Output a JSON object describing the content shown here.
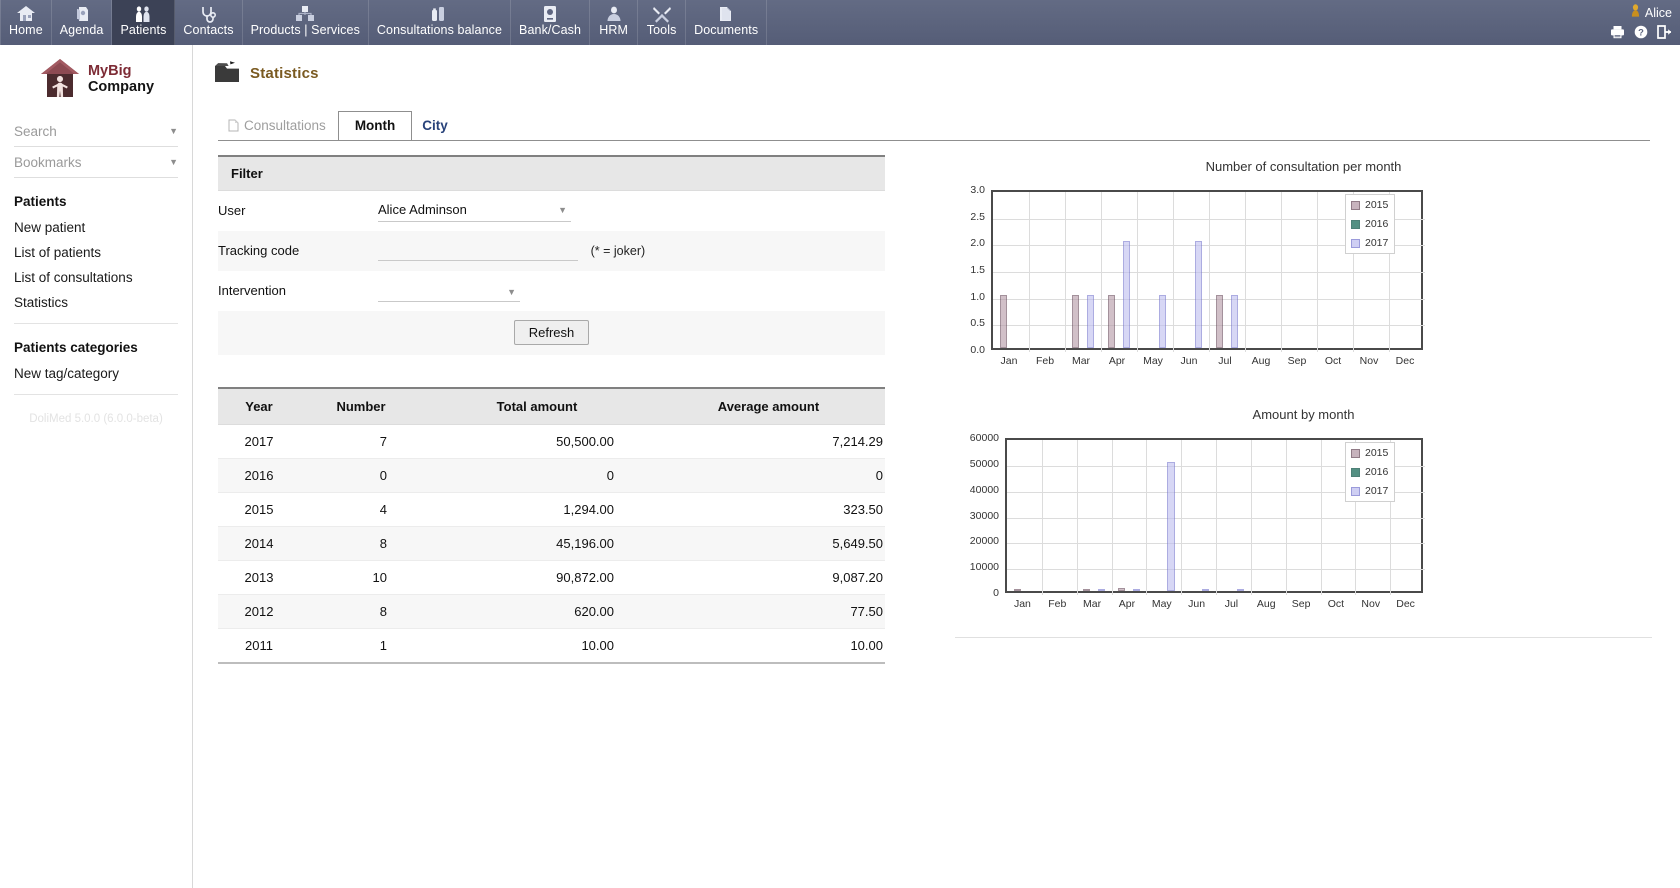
{
  "topbar": {
    "menu": [
      {
        "label": "Home",
        "icon": "home-icon",
        "active": false
      },
      {
        "label": "Agenda",
        "icon": "agenda-icon",
        "active": false
      },
      {
        "label": "Patients",
        "icon": "patients-icon",
        "active": true
      },
      {
        "label": "Contacts",
        "icon": "stethoscope-icon",
        "active": false
      },
      {
        "label": "Products | Services",
        "icon": "products-icon",
        "active": false
      },
      {
        "label": "Consultations balance",
        "icon": "balance-icon",
        "active": false
      },
      {
        "label": "Bank/Cash",
        "icon": "bank-icon",
        "active": false
      },
      {
        "label": "HRM",
        "icon": "hrm-icon",
        "active": false
      },
      {
        "label": "Tools",
        "icon": "tools-icon",
        "active": false
      },
      {
        "label": "Documents",
        "icon": "documents-icon",
        "active": false
      }
    ],
    "user": "Alice",
    "user_icon": "user-avatar-icon",
    "icons": [
      "print-icon",
      "help-icon",
      "logout-icon"
    ]
  },
  "sidebar": {
    "logo": {
      "line1": "MyBig",
      "line2": "Company",
      "icon": "company-house-logo"
    },
    "search": {
      "placeholder": "Search",
      "caret": "▼"
    },
    "bookmarks": {
      "placeholder": "Bookmarks",
      "caret": "▼"
    },
    "groups": [
      {
        "title": "Patients",
        "items": [
          {
            "label": "New patient"
          },
          {
            "label": "List of patients"
          },
          {
            "label": "List of consultations"
          },
          {
            "label": "Statistics"
          }
        ]
      },
      {
        "title": "Patients categories",
        "items": [
          {
            "label": "New tag/category"
          }
        ]
      }
    ],
    "version": "DoliMed 5.0.0 (6.0.0-beta)"
  },
  "page": {
    "title": "Statistics",
    "title_icon": "folder-statistics-icon",
    "tabs": [
      {
        "label": "Consultations",
        "state": "disabled",
        "icon": "document-icon"
      },
      {
        "label": "Month",
        "state": "active",
        "icon": null
      },
      {
        "label": "City",
        "state": "link",
        "icon": null
      }
    ]
  },
  "filter": {
    "heading": "Filter",
    "user_label": "User",
    "user_value": "Alice Adminson",
    "tracking_label": "Tracking code",
    "tracking_value": "",
    "tracking_placeholder": "",
    "tracking_hint": "(* = joker)",
    "intervention_label": "Intervention",
    "intervention_value": "",
    "refresh_label": "Refresh",
    "caret": "▼"
  },
  "table": {
    "columns": [
      "Year",
      "Number",
      "Total amount",
      "Average amount"
    ],
    "rows": [
      {
        "year": "2017",
        "number": "7",
        "total": "50,500.00",
        "average": "7,214.29"
      },
      {
        "year": "2016",
        "number": "0",
        "total": "0",
        "average": "0"
      },
      {
        "year": "2015",
        "number": "4",
        "total": "1,294.00",
        "average": "323.50"
      },
      {
        "year": "2014",
        "number": "8",
        "total": "45,196.00",
        "average": "5,649.50"
      },
      {
        "year": "2013",
        "number": "10",
        "total": "90,872.00",
        "average": "9,087.20"
      },
      {
        "year": "2012",
        "number": "8",
        "total": "620.00",
        "average": "77.50"
      },
      {
        "year": "2011",
        "number": "1",
        "total": "10.00",
        "average": "10.00"
      }
    ]
  },
  "colors": {
    "series_2015": "#b59aa8",
    "series_2016": "#1b6b5a",
    "series_2017": "#bfbff0",
    "series_2015_edge": "#6b4f5e",
    "series_2016_edge": "#14564a",
    "series_2017_edge": "#7a7ad0",
    "accent": "#7a5a21",
    "topbar": "#5d6580",
    "tab_link": "#28427a"
  },
  "chart_data": [
    {
      "type": "bar",
      "title": "Number of consultation per month",
      "xlabel": "",
      "ylabel": "",
      "ylim": [
        0,
        3.0
      ],
      "yticks": [
        "0.0",
        "0.5",
        "1.0",
        "1.5",
        "2.0",
        "2.5",
        "3.0"
      ],
      "ytick_values": [
        0,
        0.5,
        1.0,
        1.5,
        2.0,
        2.5,
        3.0
      ],
      "grid": true,
      "legend_position": "right",
      "categories": [
        "Jan",
        "Feb",
        "Mar",
        "Apr",
        "May",
        "Jun",
        "Jul",
        "Aug",
        "Sep",
        "Oct",
        "Nov",
        "Dec"
      ],
      "series": [
        {
          "name": "2015",
          "values": [
            1,
            0,
            1,
            1,
            0,
            0,
            1,
            0,
            0,
            0,
            0,
            0
          ]
        },
        {
          "name": "2016",
          "values": [
            0,
            0,
            0,
            0,
            0,
            0,
            0,
            0,
            0,
            0,
            0,
            0
          ]
        },
        {
          "name": "2017",
          "values": [
            0,
            0,
            1,
            2,
            1,
            2,
            1,
            0,
            0,
            0,
            0,
            0
          ]
        }
      ]
    },
    {
      "type": "bar",
      "title": "Amount by month",
      "xlabel": "",
      "ylabel": "",
      "ylim": [
        0,
        60000
      ],
      "yticks": [
        "0",
        "10000",
        "20000",
        "30000",
        "40000",
        "50000",
        "60000"
      ],
      "ytick_values": [
        0,
        10000,
        20000,
        30000,
        40000,
        50000,
        60000
      ],
      "grid": true,
      "legend_position": "right",
      "categories": [
        "Jan",
        "Feb",
        "Mar",
        "Apr",
        "May",
        "Jun",
        "Jul",
        "Aug",
        "Sep",
        "Oct",
        "Nov",
        "Dec"
      ],
      "series": [
        {
          "name": "2015",
          "values": [
            10,
            0,
            284,
            1000,
            0,
            0,
            0,
            0,
            0,
            0,
            0,
            0
          ]
        },
        {
          "name": "2016",
          "values": [
            0,
            0,
            0,
            0,
            0,
            0,
            0,
            0,
            0,
            0,
            0,
            0
          ]
        },
        {
          "name": "2017",
          "values": [
            0,
            0,
            200,
            300,
            50000,
            200,
            100,
            0,
            0,
            0,
            0,
            0
          ]
        }
      ]
    }
  ]
}
